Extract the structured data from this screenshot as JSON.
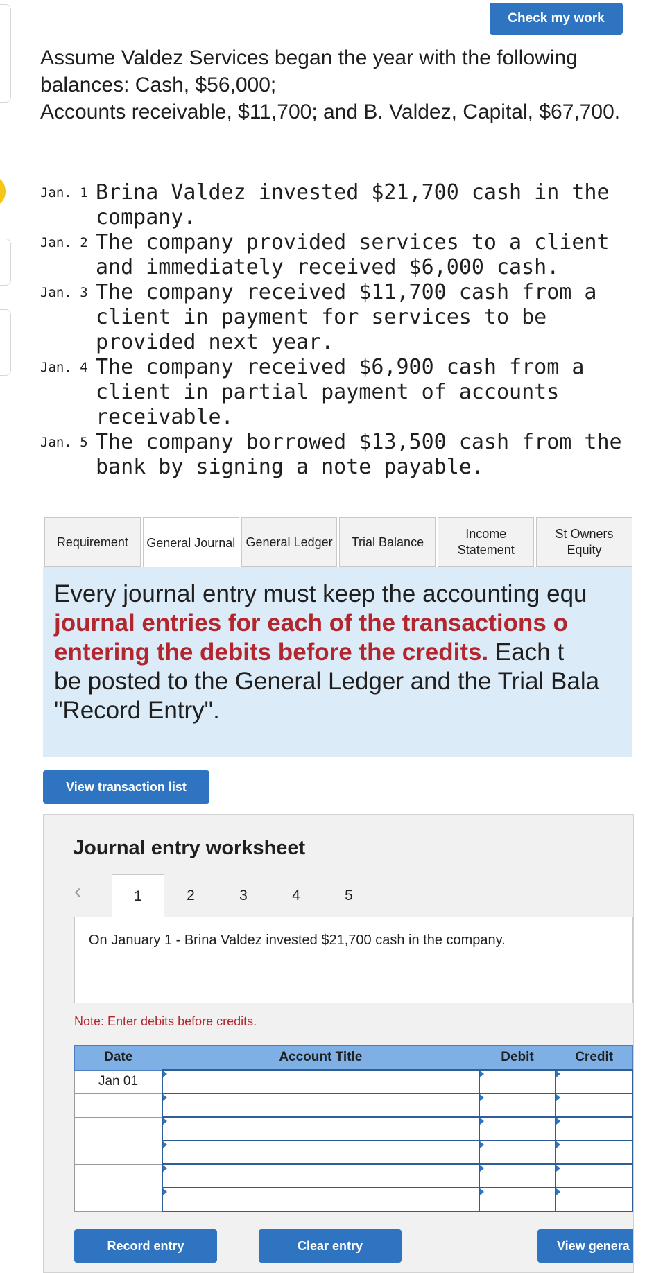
{
  "header": {
    "check_button": "Check my work"
  },
  "intro": {
    "line1": "Assume Valdez Services began the year with the following balances:  Cash, $56,000;",
    "line2": "Accounts receivable, $11,700; and B. Valdez, Capital, $67,700."
  },
  "transactions": [
    {
      "month": "Jan.",
      "day": "1",
      "text": "Brina Valdez invested $21,700 cash in the company."
    },
    {
      "month": "Jan.",
      "day": "2",
      "text": "The company provided services to a client and immediately received $6,000 cash."
    },
    {
      "month": "Jan.",
      "day": "3",
      "text": "The company received $11,700 cash from a client in payment for services to be provided next year."
    },
    {
      "month": "Jan.",
      "day": "4",
      "text": "The company received $6,900 cash from a client in partial payment of accounts receivable."
    },
    {
      "month": "Jan.",
      "day": "5",
      "text": "The company borrowed $13,500 cash from the bank by signing a note payable."
    }
  ],
  "tabs": [
    {
      "label": "Requirement",
      "active": false
    },
    {
      "label": "General Journal",
      "active": true
    },
    {
      "label": "General Ledger",
      "active": false
    },
    {
      "label": "Trial Balance",
      "active": false
    },
    {
      "label": "Income Statement",
      "active": false
    },
    {
      "label": "St Owners Equity",
      "active": false
    }
  ],
  "instructions": {
    "part1": "Every journal entry must keep the accounting equ",
    "part2_red": "journal entries for each of the transactions o",
    "part3_red": "entering the debits before the credits.",
    "part4": " Each t",
    "part5": "be posted to the General Ledger and the Trial Bala",
    "part6": "\"Record Entry\"."
  },
  "view_transaction_list": "View transaction list",
  "worksheet": {
    "title": "Journal entry worksheet",
    "pages": [
      "1",
      "2",
      "3",
      "4",
      "5"
    ],
    "active_page": "1",
    "description": "On January 1 - Brina Valdez invested $21,700 cash in the company.",
    "note": "Note: Enter debits before credits.",
    "columns": {
      "date": "Date",
      "account": "Account Title",
      "debit": "Debit",
      "credit": "Credit"
    },
    "rows": [
      {
        "date": "Jan 01",
        "account": "",
        "debit": "",
        "credit": ""
      },
      {
        "date": "",
        "account": "",
        "debit": "",
        "credit": ""
      },
      {
        "date": "",
        "account": "",
        "debit": "",
        "credit": ""
      },
      {
        "date": "",
        "account": "",
        "debit": "",
        "credit": ""
      },
      {
        "date": "",
        "account": "",
        "debit": "",
        "credit": ""
      },
      {
        "date": "",
        "account": "",
        "debit": "",
        "credit": ""
      }
    ],
    "buttons": {
      "record": "Record entry",
      "clear": "Clear entry",
      "view_general": "View genera"
    }
  },
  "colors": {
    "primary_button": "#2f74c0",
    "table_header": "#7fb0e5",
    "instructions_bg": "#dcebf8",
    "accent_red": "#b3262d"
  },
  "icons": {
    "prev_page": "chevron-left-icon"
  }
}
